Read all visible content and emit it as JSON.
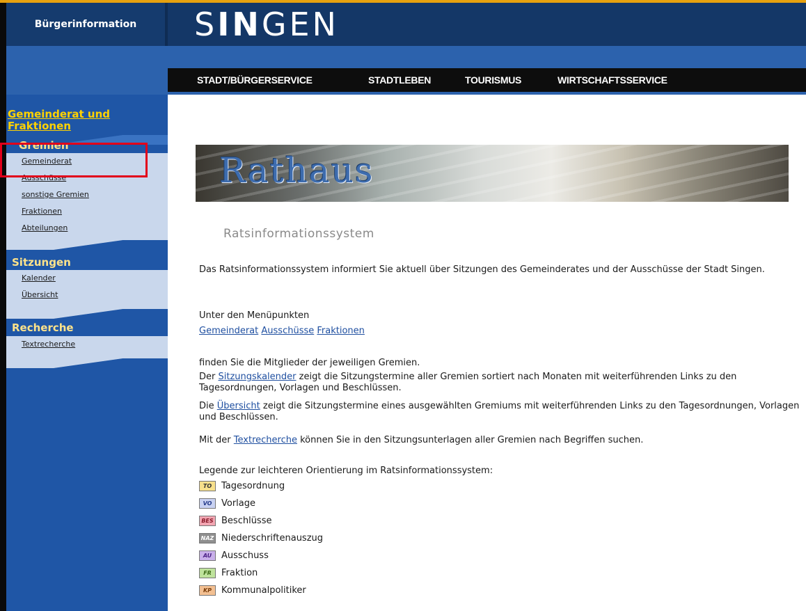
{
  "header": {
    "brand_label": "Bürgerinformation",
    "logo_bold": "IN",
    "logo_s": "S",
    "logo_rest": "GEN"
  },
  "topnav": [
    "STADT/BÜRGERSERVICE",
    "STADTLEBEN",
    "TOURISMUS",
    "WIRTSCHAFTSSERVICE"
  ],
  "sidebar": {
    "top_link": "Gemeinderat und Fraktionen",
    "gremien_heading": "Gremien",
    "gremien_items": [
      "Gemeinderat",
      "Ausschüsse",
      "sonstige Gremien",
      "Fraktionen",
      "Abteilungen"
    ],
    "sitzungen_heading": "Sitzungen",
    "sitzungen_items": [
      "Kalender",
      "Übersicht"
    ],
    "recherche_heading": "Recherche",
    "recherche_items": [
      "Textrecherche"
    ]
  },
  "banner_title": "Rathaus",
  "page_title": "Ratsinformationssystem",
  "intro": "Das Ratsinformationssystem informiert Sie aktuell über Sitzungen des Gemeinderates und der Ausschüsse der Stadt Singen.",
  "menu_intro": "Unter den Menüpunkten",
  "menu_links": [
    "Gemeinderat",
    "Ausschüsse",
    "Fraktionen"
  ],
  "p_members": "finden Sie die Mitglieder der jeweiligen Gremien.",
  "p_kalender": {
    "pre": "Der ",
    "link": "Sitzungskalender",
    "post": " zeigt die Sitzungstermine aller Gremien sortiert nach Monaten mit weiterführenden Links zu den Tagesordnungen, Vorlagen und Beschlüssen."
  },
  "p_uebersicht": {
    "pre": "Die ",
    "link": "Übersicht",
    "post": " zeigt die Sitzungstermine eines ausgewählten Gremiums mit weiterführenden Links zu den Tagesordnungen, Vorlagen und Beschlüssen."
  },
  "p_text": {
    "pre": "Mit der ",
    "link": "Textrecherche",
    "post": " können Sie in den Sitzungsunterlagen aller Gremien nach Begriffen suchen."
  },
  "legend_title": "Legende zur leichteren Orientierung im Ratsinformationssystem:",
  "legend": [
    {
      "code": "TO",
      "label": "Tagesordnung",
      "bg": "#f7e08c",
      "fg": "#333"
    },
    {
      "code": "VO",
      "label": "Vorlage",
      "bg": "#c9d2f2",
      "fg": "#243a8a"
    },
    {
      "code": "BES",
      "label": "Beschlüsse",
      "bg": "#f2a6b2",
      "fg": "#8a1a2a"
    },
    {
      "code": "NAZ",
      "label": "Niederschriftenauszug",
      "bg": "#8f8f8f",
      "fg": "#fff"
    },
    {
      "code": "AU",
      "label": "Ausschuss",
      "bg": "#c9b0ea",
      "fg": "#4a1f86"
    },
    {
      "code": "FR",
      "label": "Fraktion",
      "bg": "#bfe39c",
      "fg": "#3b6a16"
    },
    {
      "code": "KP",
      "label": "Kommunalpolitiker",
      "bg": "#f3c092",
      "fg": "#7a3d0a"
    }
  ]
}
